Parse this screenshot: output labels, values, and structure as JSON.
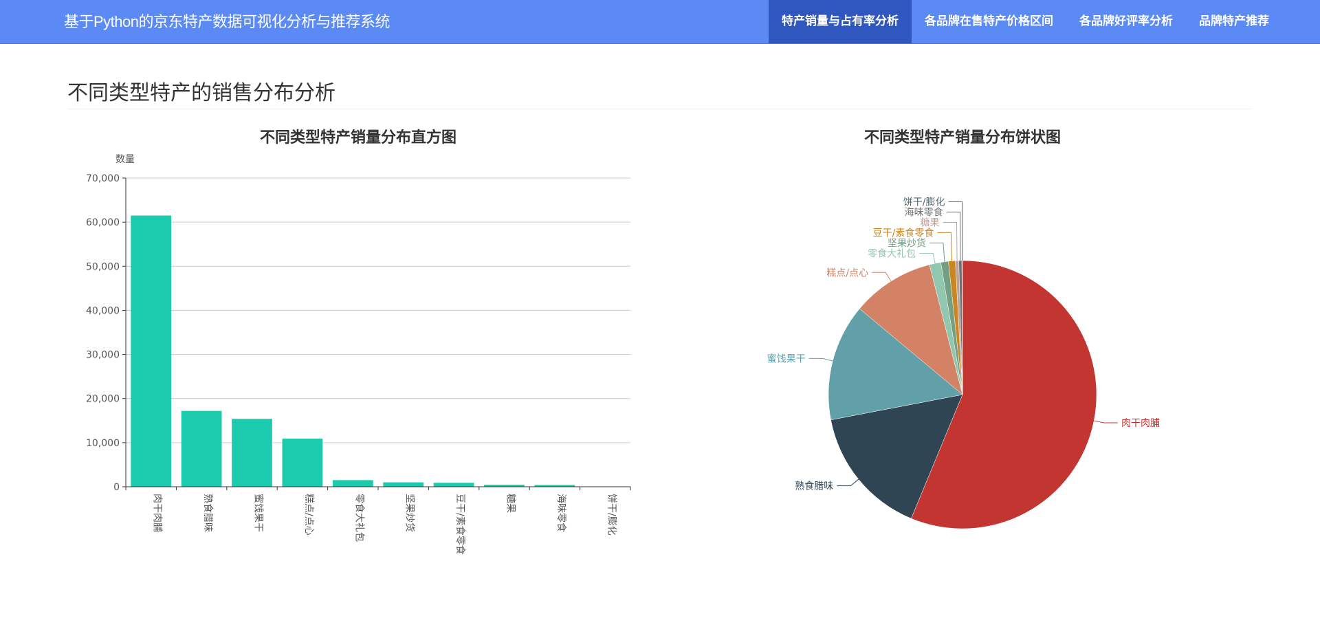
{
  "app": {
    "title": "基于Python的京东特产数据可视化分析与推荐系统"
  },
  "nav": {
    "items": [
      {
        "label": "特产销量与占有率分析",
        "active": true
      },
      {
        "label": "各品牌在售特产价格区间",
        "active": false
      },
      {
        "label": "各品牌好评率分析",
        "active": false
      },
      {
        "label": "品牌特产推荐",
        "active": false
      }
    ]
  },
  "page": {
    "title": "不同类型特产的销售分布分析"
  },
  "chart_data": [
    {
      "type": "bar",
      "title": "不同类型特产销量分布直方图",
      "ylabel": "数量",
      "xlabel": "",
      "ylim": [
        0,
        70000
      ],
      "yticks": [
        0,
        10000,
        20000,
        30000,
        40000,
        50000,
        60000,
        70000
      ],
      "ytick_labels": [
        "0",
        "10,000",
        "20,000",
        "30,000",
        "40,000",
        "50,000",
        "60,000",
        "70,000"
      ],
      "grid": true,
      "color": "#1ccaad",
      "categories": [
        "肉干肉脯",
        "熟食腊味",
        "蜜饯果干",
        "糕点/点心",
        "零食大礼包",
        "坚果炒货",
        "豆干/素食零食",
        "糖果",
        "海味零食",
        "饼干/膨化"
      ],
      "values": [
        61500,
        17200,
        15400,
        10900,
        1500,
        1000,
        900,
        450,
        400,
        80
      ]
    },
    {
      "type": "pie",
      "title": "不同类型特产销量分布饼状图",
      "labels": [
        "肉干肉脯",
        "熟食腊味",
        "蜜饯果干",
        "糕点/点心",
        "零食大礼包",
        "坚果炒货",
        "豆干/素食零食",
        "糖果",
        "海味零食",
        "饼干/膨化"
      ],
      "values": [
        61500,
        17200,
        15400,
        10900,
        1500,
        1000,
        900,
        450,
        400,
        80
      ],
      "colors": [
        "#c23531",
        "#2f4554",
        "#61a0a8",
        "#d48265",
        "#91c7ae",
        "#749f83",
        "#ca8622",
        "#bda29a",
        "#6e7074",
        "#546570"
      ]
    }
  ]
}
